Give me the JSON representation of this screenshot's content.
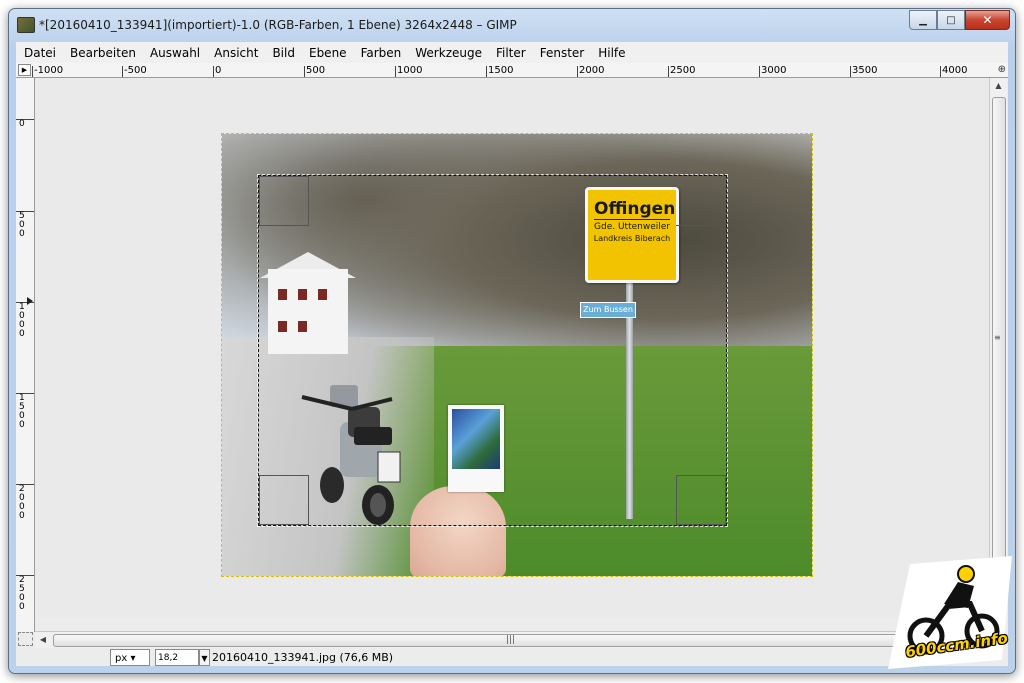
{
  "window": {
    "title": "*[20160410_133941](importiert)-1.0 (RGB-Farben, 1 Ebene) 3264x2448 – GIMP",
    "controls": {
      "minimize": "▁",
      "maximize": "□",
      "close": "✕"
    }
  },
  "menubar": {
    "items": [
      "Datei",
      "Bearbeiten",
      "Auswahl",
      "Ansicht",
      "Bild",
      "Ebene",
      "Farben",
      "Werkzeuge",
      "Filter",
      "Fenster",
      "Hilfe"
    ]
  },
  "ruler": {
    "horizontal_labels": [
      "-1000",
      "-500",
      "0",
      "500",
      "1000",
      "1500",
      "2000",
      "2500",
      "3000",
      "3500",
      "4000"
    ],
    "vertical_labels": [
      "0",
      "500",
      "1000",
      "1500",
      "2000",
      "2500"
    ]
  },
  "image": {
    "sign": {
      "town": "Offingen",
      "line1": "Gde. Uttenweiler",
      "line2": "Landkreis Biberach"
    },
    "street_sign": "Zum Bussen"
  },
  "statusbar": {
    "unit": "px",
    "zoom": "18,2",
    "file_info": "20160410_133941.jpg (76,6 MB)"
  },
  "watermark": {
    "text": "600ccm.info"
  },
  "colors": {
    "sign_yellow": "#f2c300",
    "selection_border": "#111111",
    "layer_border": "#d4c300"
  }
}
